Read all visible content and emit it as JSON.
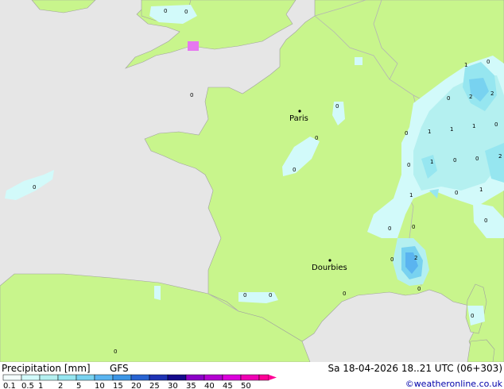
{
  "map": {
    "cities": [
      {
        "name": "Paris"
      },
      {
        "name": "Dourbies"
      }
    ],
    "grid_values": [
      "0",
      "0",
      "0",
      "0",
      "0",
      "0",
      "0",
      "1",
      "0",
      "2",
      "2",
      "0",
      "1",
      "1",
      "1",
      "0",
      "0",
      "1",
      "0",
      "2",
      "0",
      "1",
      "0",
      "1",
      "0",
      "0",
      "0",
      "0",
      "2",
      "0",
      "0",
      "0",
      "0",
      "0",
      "0",
      "0"
    ]
  },
  "footer": {
    "title": "Precipitation [mm]",
    "model": "GFS",
    "datetime": "Sa 18-04-2026 18..21 UTC (06+303)",
    "credit": "©weatheronline.co.uk",
    "scale_labels": [
      "0.1",
      "0.5",
      "1",
      "2",
      "5",
      "10",
      "15",
      "20",
      "25",
      "30",
      "35",
      "40",
      "45",
      "50"
    ],
    "scale_colors": [
      "#f4ffff",
      "#d2fafa",
      "#b4f0f0",
      "#96e6f0",
      "#78d2f0",
      "#5ab4f0",
      "#3c96e6",
      "#2864d2",
      "#1e32b4",
      "#140a8c",
      "#8c00c8",
      "#b400d2",
      "#dc00dc",
      "#f000b4",
      "#ff0096"
    ]
  },
  "colors": {
    "land": "#c8f58c",
    "sea": "#e6e6e6",
    "border": "#b4b4b4",
    "coast": "#a0a0a0"
  }
}
